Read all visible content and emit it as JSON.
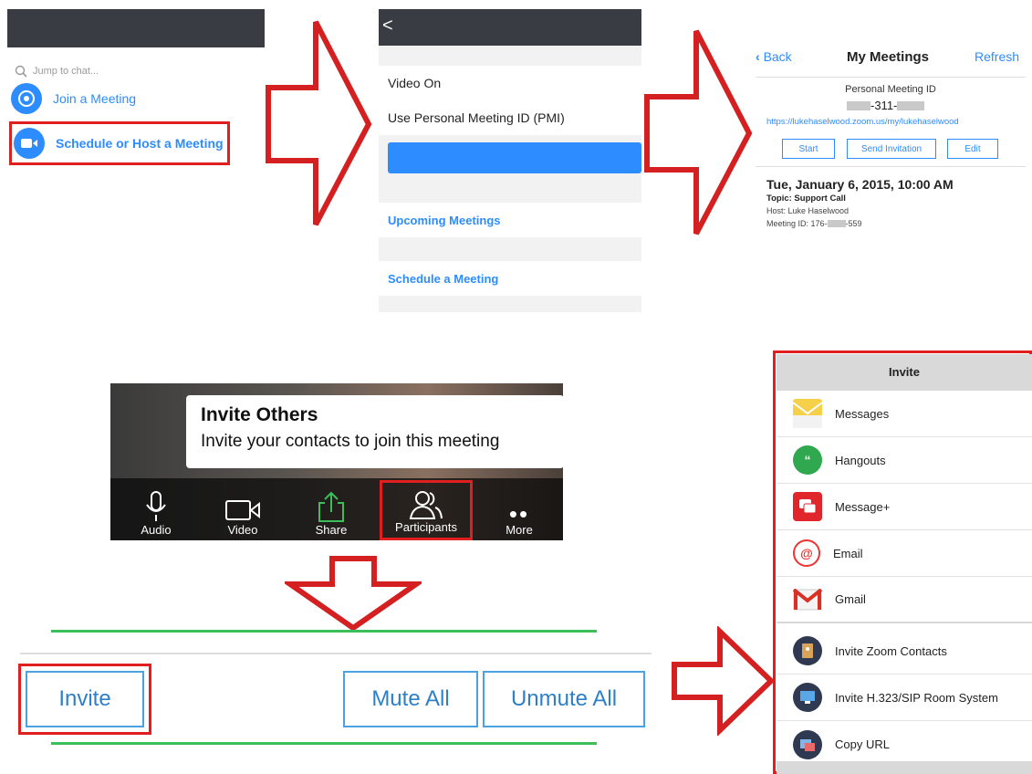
{
  "panel1": {
    "search_placeholder": "Jump to chat...",
    "join_label": "Join a Meeting",
    "schedule_label": "Schedule or Host a Meeting"
  },
  "panel2": {
    "back_glyph": "<",
    "video_on": "Video On",
    "use_pmi": "Use Personal Meeting ID (PMI)",
    "upcoming": "Upcoming Meetings",
    "schedule": "Schedule a Meeting"
  },
  "panel3": {
    "back": "Back",
    "title": "My Meetings",
    "refresh": "Refresh",
    "pmi_label": "Personal Meeting ID",
    "pmi_mid": "-311-",
    "url": "https://lukehaselwood.zoom.us/my/lukehaselwood",
    "start": "Start",
    "send_invitation": "Send Invitation",
    "edit": "Edit",
    "meeting_date": "Tue, January 6, 2015, 10:00 AM",
    "topic": "Topic: Support Call",
    "host": "Host: Luke Haselwood",
    "meeting_id_prefix": "Meeting ID: 176-",
    "meeting_id_suffix": "-559"
  },
  "video": {
    "tooltip_title": "Invite Others",
    "tooltip_text": "Invite your contacts to join this meeting",
    "audio": "Audio",
    "video": "Video",
    "share": "Share",
    "participants": "Participants",
    "more": "More"
  },
  "participants_bar": {
    "invite": "Invite",
    "mute_all": "Mute All",
    "unmute_all": "Unmute All"
  },
  "invite_panel": {
    "title": "Invite",
    "items": [
      {
        "label": "Messages",
        "icon": "messages-icon"
      },
      {
        "label": "Hangouts",
        "icon": "hangouts-icon"
      },
      {
        "label": "Message+",
        "icon": "message-plus-icon"
      },
      {
        "label": "Email",
        "icon": "email-icon"
      },
      {
        "label": "Gmail",
        "icon": "gmail-icon"
      },
      {
        "label": "Invite Zoom Contacts",
        "icon": "zoom-contacts-icon"
      },
      {
        "label": "Invite H.323/SIP Room System",
        "icon": "room-system-icon"
      },
      {
        "label": "Copy URL",
        "icon": "copy-url-icon"
      }
    ]
  },
  "colors": {
    "accent_blue": "#2d8cff",
    "highlight_red": "#e02020",
    "arrow_red": "#d42020",
    "divider_green": "#3cbf5a"
  }
}
